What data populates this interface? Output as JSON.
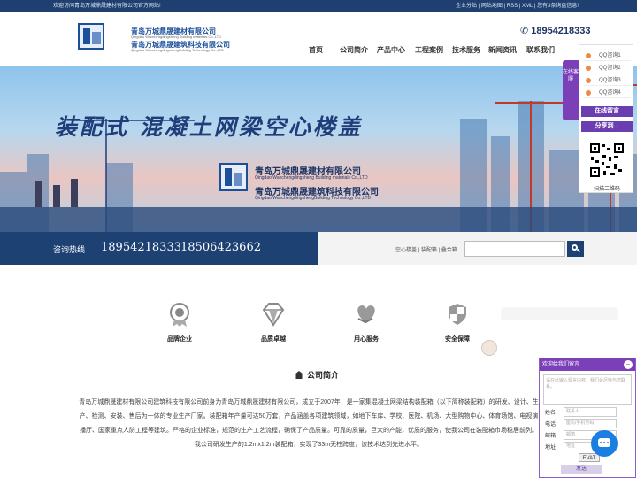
{
  "topbar": {
    "welcome": "欢迎访问青岛万城鼎晟建材有限公司官方网站!",
    "links": "企业分站 | 网站地图 | RSS | XML | 您有3条询盘信息!"
  },
  "header": {
    "company_cn_1": "青岛万城鼎晟建材有限公司",
    "company_en_1": "Qingdao Wanchengdingsheng Building materials Co.,LTD",
    "company_cn_2": "青岛万城鼎晟建筑科技有限公司",
    "company_en_2": "Qingdao WanchengdingshengBuilding Technology Co.,LTD",
    "phone": "18954218333"
  },
  "nav": [
    "首页",
    "公司简介",
    "产品中心",
    "工程案例",
    "技术服务",
    "新闻资讯",
    "联系我们"
  ],
  "banner": {
    "slogan": "装配式  混凝土网梁空心楼盖",
    "company_cn_1": "青岛万城鼎晟建材有限公司",
    "company_en_1": "Qingdao Wanchengdingsheng Building materials Co.,LTD",
    "company_cn_2": "青岛万城鼎晟建筑科技有限公司",
    "company_en_2": "Qingdao WanchengdingshengBuilding Technology Co.,LTD"
  },
  "hotline": {
    "label": "咨询热线",
    "number1": "18954218333",
    "number2": "18506423662",
    "keywords": "空心楼盖 | 装配箱 | 叠合箱"
  },
  "features": [
    {
      "label": "品牌企业",
      "icon": "medal-icon"
    },
    {
      "label": "品质卓越",
      "icon": "diamond-icon"
    },
    {
      "label": "用心服务",
      "icon": "heart-hand-icon"
    },
    {
      "label": "安全保障",
      "icon": "shield-icon"
    }
  ],
  "about": {
    "title": "公司简介",
    "text": "青岛万城鼎晟建材有限公司建筑科技有限公司前身为青岛万城鼎晟建材有限公司，成立于2007年，是一家集混凝土网梁结构装配箱（以下简称装配箱）的研发、设计、生产、检测、安装、售后为一体的专业生产厂家。装配箱年产量可达50万套，产品涵盖各项建筑领域，如地下车库、学校、医院、机场、大型购物中心、体育场馆、电视演播厅、国家重点人防工程等建筑。严格的企业标准，规范的生产工艺流程，确保了产品质量。可靠的质量，巨大的产能，优质的服务，使我公司在装配箱市场稳居前列。我公司研发生产的1.2mx1.2m装配箱，实现了33m无柱跨度，该技术达到先进水平。"
  },
  "sidebar": {
    "tab": "在线客服",
    "qq": [
      "QQ咨询1",
      "QQ咨询2",
      "QQ咨询3",
      "QQ咨询4"
    ],
    "message_btn": "在线留言",
    "share_btn": "分享到...",
    "qr_label": "扫描二维码"
  },
  "message": {
    "title": "欢迎给我们留言",
    "close": "−",
    "placeholder": "请在此输入留言内容，我们会尽快与您联系。",
    "fields": [
      {
        "label": "姓名",
        "placeholder": "联系人"
      },
      {
        "label": "电话",
        "placeholder": "座机/手机号码"
      },
      {
        "label": "邮箱",
        "placeholder": "邮箱"
      },
      {
        "label": "地址",
        "placeholder": "地址"
      }
    ],
    "captcha": "EVAT",
    "submit": "发送"
  },
  "colors": {
    "primary": "#1d4172",
    "accent": "#7b3fb8"
  }
}
